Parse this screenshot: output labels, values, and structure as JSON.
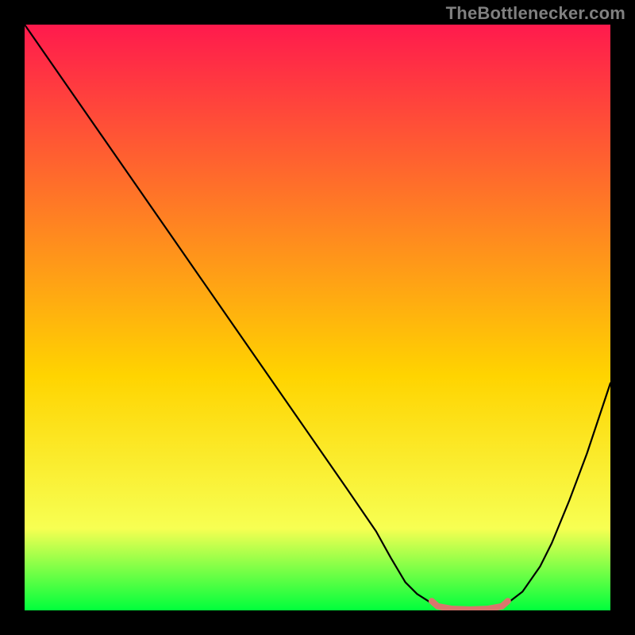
{
  "watermark": "TheBottlenecker.com",
  "chart_data": {
    "type": "line",
    "title": "",
    "xlabel": "",
    "ylabel": "",
    "xlim": [
      0,
      100
    ],
    "ylim": [
      0,
      100
    ],
    "grid": false,
    "legend": false,
    "axes": false,
    "gradient": {
      "top_color": "#ff1a4d",
      "mid_color": "#ffd400",
      "bottom_color": "#00ff3c"
    },
    "series": [
      {
        "name": "bottleneck-curve",
        "color": "#000000",
        "x": [
          0,
          5,
          10,
          15,
          20,
          25,
          30,
          35,
          40,
          45,
          50,
          55,
          60,
          62.5,
          65,
          67,
          70,
          73,
          76,
          80,
          82,
          85,
          88,
          90,
          93,
          96,
          100
        ],
        "y": [
          100,
          92.8,
          85.6,
          78.4,
          71.2,
          64.0,
          56.8,
          49.6,
          42.4,
          35.2,
          28.0,
          20.8,
          13.5,
          9.0,
          4.8,
          2.8,
          0.9,
          0.25,
          0.15,
          0.25,
          0.9,
          3.2,
          7.5,
          11.5,
          18.8,
          26.8,
          38.8
        ]
      },
      {
        "name": "optimal-range-marker",
        "color": "#d9766d",
        "x": [
          69.5,
          70.5,
          73,
          76,
          79,
          81.5,
          82.5
        ],
        "y": [
          1.6,
          0.7,
          0.25,
          0.15,
          0.25,
          0.7,
          1.6
        ]
      }
    ]
  }
}
